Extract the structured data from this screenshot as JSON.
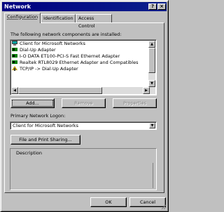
{
  "window": {
    "title": "Network",
    "help_label": "?",
    "close_label": "×"
  },
  "tabs": [
    {
      "label": "Configuration",
      "active": true
    },
    {
      "label": "Identification",
      "active": false
    },
    {
      "label": "Access Control",
      "active": false
    }
  ],
  "components": {
    "label": "The following network components are installed:",
    "items": [
      {
        "label": "Client for Microsoft Networks",
        "icon": "client-icon"
      },
      {
        "label": "Dial-Up Adapter",
        "icon": "adapter-icon"
      },
      {
        "label": "I-O DATA ET100-PCI-S Fast Ethernet Adapter",
        "icon": "adapter-icon"
      },
      {
        "label": "Realtek RTL8029 Ethernet Adapter and Compatibles",
        "icon": "adapter-icon"
      },
      {
        "label": "TCP/IP -> Dial-Up Adapter",
        "icon": "protocol-icon"
      }
    ]
  },
  "buttons": {
    "add": "Add...",
    "remove": "Remove",
    "properties": "Properties",
    "file_print": "File and Print Sharing...",
    "ok": "OK",
    "cancel": "Cancel"
  },
  "logon": {
    "label": "Primary Network Logon:",
    "value": "Client for Microsoft Networks"
  },
  "description": {
    "label": "Description"
  },
  "colors": {
    "title_bar": "#000080",
    "face": "#c0c0c0",
    "icon_green": "#008000"
  }
}
